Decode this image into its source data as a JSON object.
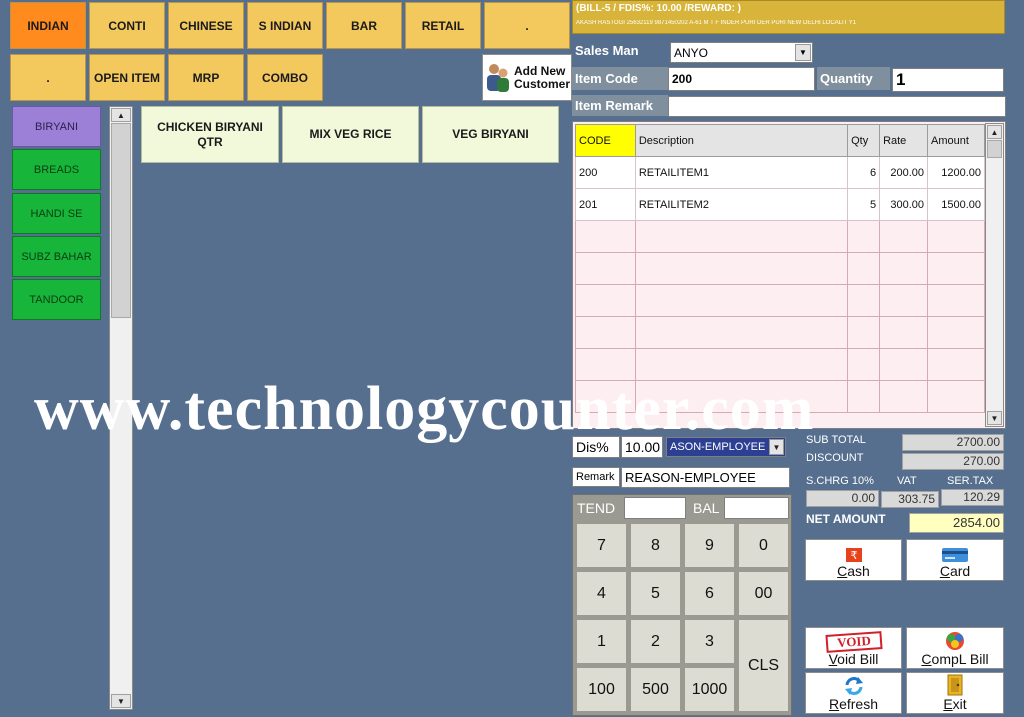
{
  "categories_row1": [
    "INDIAN",
    "CONTI",
    "CHINESE",
    "S INDIAN",
    "BAR",
    "RETAIL",
    "."
  ],
  "categories_row2": [
    ".",
    "OPEN ITEM",
    "MRP",
    "COMBO"
  ],
  "add_customer": {
    "line1": "Add New",
    "line2": "Customer"
  },
  "subcategories": [
    "BIRYANI",
    "BREADS",
    "HANDI SE",
    "SUBZ BAHAR",
    "TANDOOR"
  ],
  "items": [
    "CHICKEN BIRYANI QTR",
    "MIX VEG RICE",
    "VEG BIRYANI"
  ],
  "bill_header": {
    "title": "(BILL-5  / FDIS%: 10.00 /REWARD: )",
    "customer": "AKASH RASTOGI   25632119   9871450202    A-61 M T F INDER PURI DER PURI NEW DELHI LOCALIT Y1"
  },
  "form": {
    "salesman_label": "Sales Man",
    "salesman_value": "ANYO",
    "item_code_label": "Item Code",
    "item_code_value": "200",
    "quantity_label": "Quantity",
    "quantity_value": "1",
    "item_remark_label": "Item Remark",
    "item_remark_value": ""
  },
  "grid": {
    "headers": [
      "CODE",
      "Description",
      "Qty",
      "Rate",
      "Amount"
    ],
    "rows": [
      [
        "200",
        "RETAILITEM1",
        "6",
        "200.00",
        "1200.00"
      ],
      [
        "201",
        "RETAILITEM2",
        "5",
        "300.00",
        "1500.00"
      ]
    ]
  },
  "discount": {
    "label": "Dis%",
    "value": "10.00",
    "reason_value": "ASON-EMPLOYEE",
    "remark_label": "Remark",
    "remark_value": "REASON-EMPLOYEE"
  },
  "totals": {
    "subtotal_label": "SUB TOTAL",
    "subtotal_value": "2700.00",
    "discount_label": "DISCOUNT",
    "discount_value": "270.00",
    "schrg_label": "S.CHRG",
    "schrg_pct": "10%",
    "schrg_value": "0.00",
    "vat_label": "VAT",
    "vat_value": "303.75",
    "sertax_label": "SER.TAX",
    "sertax_value": "120.29",
    "net_label": "NET AMOUNT",
    "net_value": "2854.00"
  },
  "tender": {
    "tend_label": "TEND",
    "bal_label": "BAL"
  },
  "keypad": {
    "k7": "7",
    "k8": "8",
    "k9": "9",
    "k0": "0",
    "k4": "4",
    "k5": "5",
    "k6": "6",
    "k00": "00",
    "k1": "1",
    "k2": "2",
    "k3": "3",
    "kcls": "CLS",
    "k100": "100",
    "k500": "500",
    "k1000": "1000"
  },
  "actions": {
    "cash": "Cash",
    "card": "Card",
    "void": "Void Bill",
    "compl": "CompL Bill",
    "refresh": "Refresh",
    "exit": "Exit",
    "void_stamp": "VOID"
  },
  "watermark": "www.technologycounter.com",
  "colors": {
    "background": "#566f8e",
    "category": "#f3c95e",
    "category_active": "#ff8a1e",
    "subcategory": "#17b53a",
    "subcategory_active": "#9c7fd6",
    "header_bar": "#d8b53a",
    "net_value_bg": "#ffffc0"
  }
}
